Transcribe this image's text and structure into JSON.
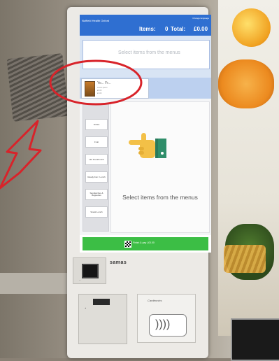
{
  "screen": {
    "topbar": {
      "brand": "Nuffield Health Oxford",
      "language": "Change language",
      "items_label": "Items:",
      "items_count": "0",
      "total_label": "Total:",
      "total_value": "£0.00"
    },
    "order_box": {
      "hint": "Select items from the menus"
    },
    "promo": {
      "name": "Yo... Fr...",
      "line1": "Lorem ipsum",
      "line2": "£0.00",
      "line3": "£1.00"
    },
    "categories": [
      "Drinks",
      "Fruit",
      "Hot Food/Lunch",
      "Ready Fan / Lunch",
      "Sandwiches & Baguettes",
      "Snack Lunch"
    ],
    "main_message": "Select items from the menus",
    "pay_button": "Finish & pay | £0.00"
  },
  "kiosk": {
    "brand_logo": "samas",
    "camera_caption": "—",
    "slot_caption": "▲",
    "reader_brand": "Cardtronics"
  },
  "colors": {
    "topbar": "#2f6fd1",
    "pay_button": "#3cbe45",
    "annotation": "#d8232a"
  }
}
